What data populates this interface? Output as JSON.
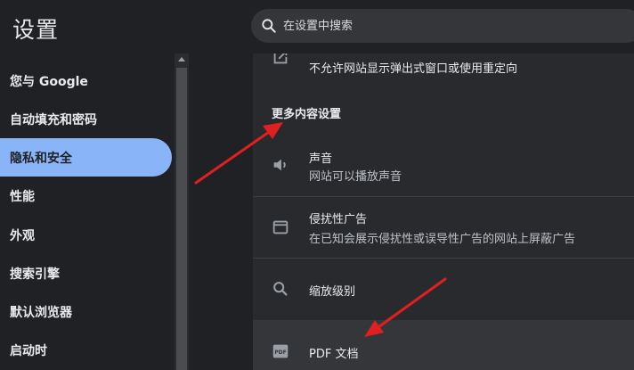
{
  "header": {
    "title": "设置",
    "search_placeholder": "在设置中搜索"
  },
  "sidebar": {
    "items": [
      {
        "label": "您与 Google",
        "active": false
      },
      {
        "label": "自动填充和密码",
        "active": false
      },
      {
        "label": "隐私和安全",
        "active": true
      },
      {
        "label": "性能",
        "active": false
      },
      {
        "label": "外观",
        "active": false
      },
      {
        "label": "搜索引擎",
        "active": false
      },
      {
        "label": "默认浏览器",
        "active": false
      },
      {
        "label": "启动时",
        "active": false
      }
    ]
  },
  "content": {
    "popups_description": "不允许网站显示弹出式窗口或使用重定向",
    "section_heading": "更多内容设置",
    "sound": {
      "title": "声音",
      "description": "网站可以播放声音",
      "icon": "speaker-icon"
    },
    "intrusive_ads": {
      "title": "侵扰性广告",
      "description": "在已知会展示侵扰性或误导性广告的网站上屏蔽广告",
      "icon": "window-icon"
    },
    "zoom": {
      "title": "缩放级别",
      "icon": "zoom-icon"
    },
    "pdf": {
      "title": "PDF 文档",
      "icon": "pdf-icon",
      "icon_text": "PDF"
    }
  },
  "colors": {
    "accent": "#8ab4f8",
    "annotation_arrow": "#e02020"
  }
}
